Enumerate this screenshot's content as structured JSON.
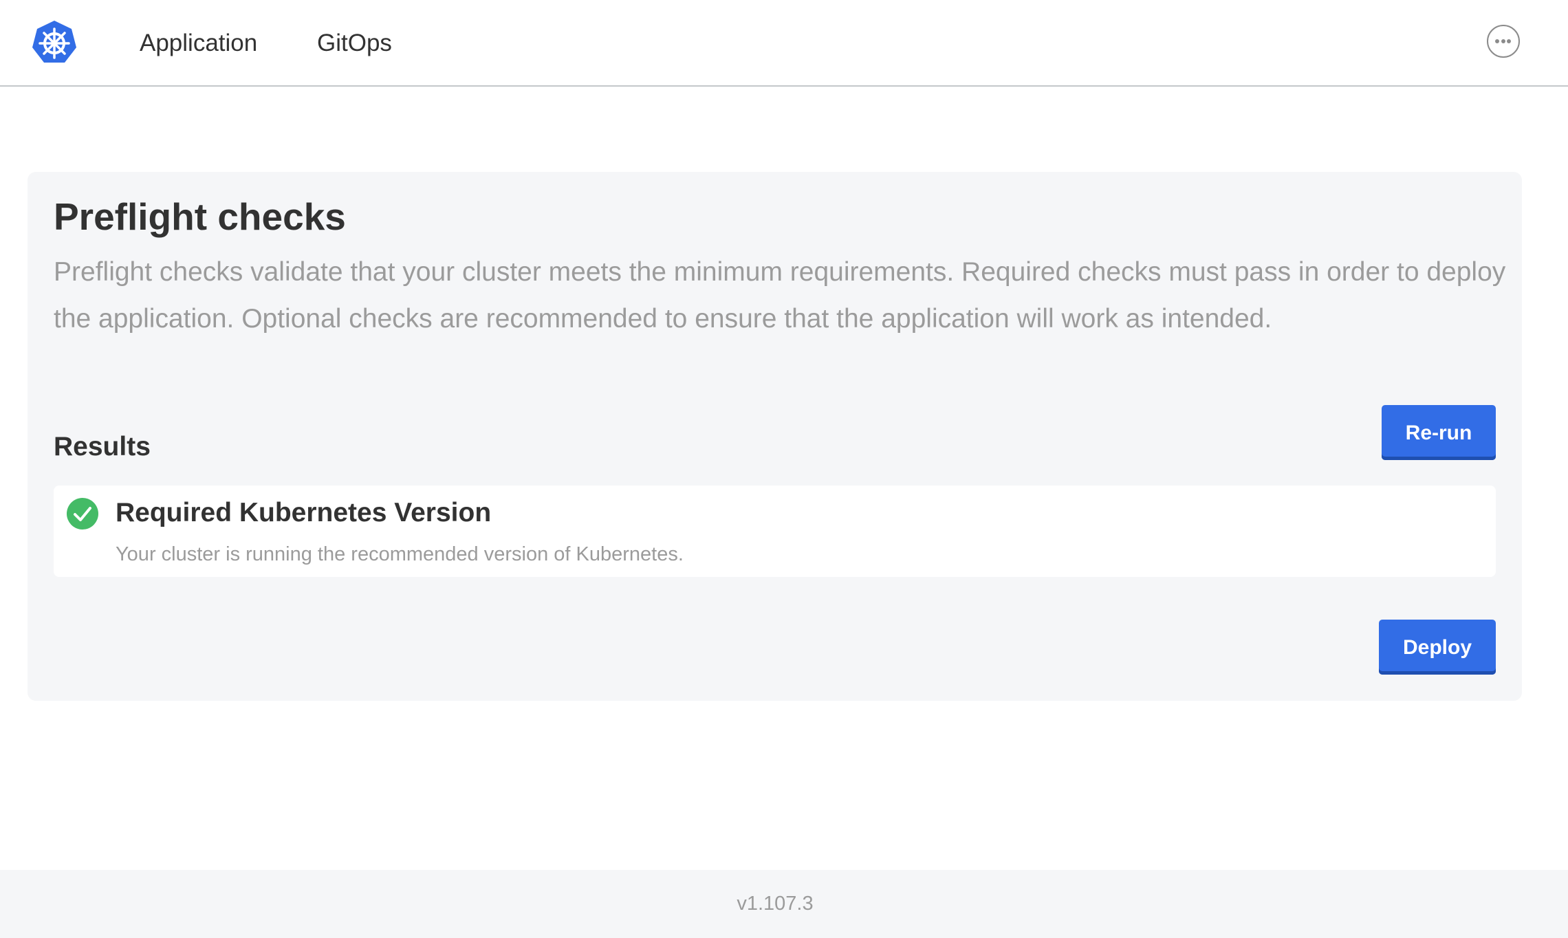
{
  "header": {
    "logo_icon": "kubernetes-helm-logo",
    "nav": [
      {
        "label": "Application"
      },
      {
        "label": "GitOps"
      }
    ],
    "more_icon": "more-horizontal-icon"
  },
  "preflight": {
    "title": "Preflight checks",
    "description": "Preflight checks validate that your cluster meets the minimum requirements. Required checks must pass in order to deploy the application. Optional checks are recommended to ensure that the application will work as intended.",
    "results_title": "Results",
    "rerun_label": "Re-run",
    "deploy_label": "Deploy",
    "results": [
      {
        "status": "pass",
        "status_icon": "check-circle-icon",
        "title": "Required Kubernetes Version",
        "message": "Your cluster is running the recommended version of Kubernetes."
      }
    ]
  },
  "footer": {
    "version": "v1.107.3"
  },
  "colors": {
    "accent": "#326de6",
    "success": "#44bb66",
    "card_bg": "#f5f6f8",
    "text": "#323232",
    "muted": "#9b9b9b"
  }
}
